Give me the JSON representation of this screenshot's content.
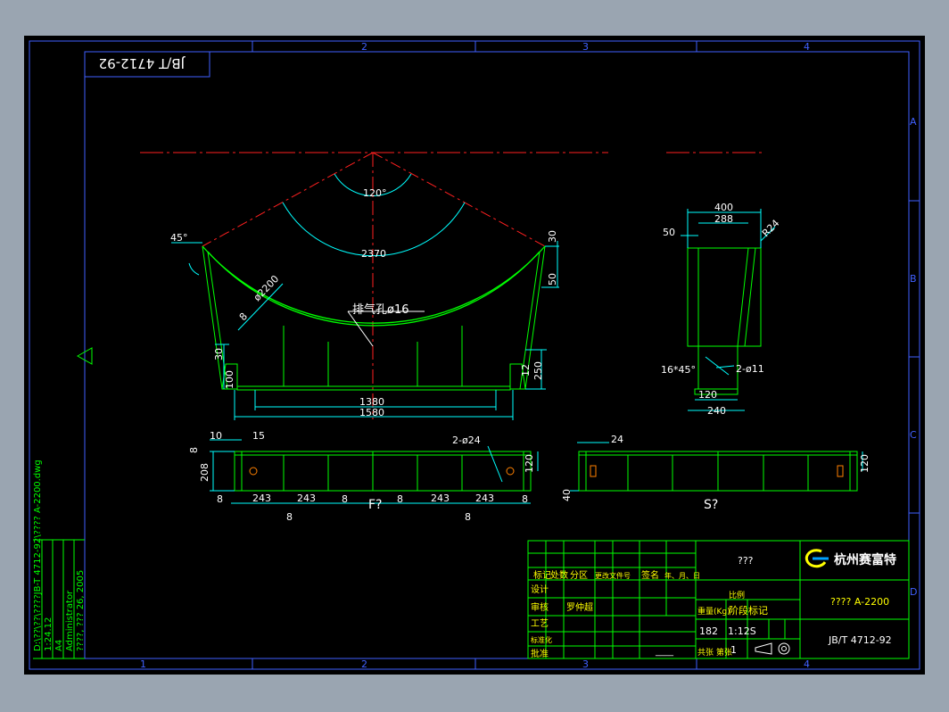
{
  "colors": {
    "background": "#9aa5b1",
    "sheet": "#000000",
    "frame": "#4060ff",
    "outline": "#00ff00",
    "centerline": "#ff2020",
    "dimension": "#00ffff",
    "text": "#ffffff",
    "title_block": "#ffff00"
  },
  "frame": {
    "col_marks_top": [
      "2",
      "3",
      "4"
    ],
    "col_marks_bottom": [
      "1",
      "2",
      "3",
      "4"
    ],
    "row_marks": [
      "A",
      "B",
      "C",
      "D"
    ]
  },
  "top_code_box": "JB/T 4712-92",
  "side_info": {
    "path": "D:\\??\\??\\????JB-T 4712-92\\???? A-2200.dwg",
    "scale": "1:24.12",
    "paper": "A4",
    "user": "Administrator",
    "date": "????, ??? 26, 2005",
    "labels": [
      "文件名",
      "比例",
      "图幅",
      "绘图者",
      "日期"
    ]
  },
  "front_view": {
    "angle": "120°",
    "arc_length": "2370",
    "chamfer_angle": "45°",
    "radius": "ø2200",
    "thickness": "8",
    "vent_hole": "排气孔ø16",
    "dim_30_top": "30",
    "dim_50": "50",
    "dim_30_left": "30",
    "dim_100": "100",
    "dim_12": "12",
    "dim_250": "250",
    "width_inner": "1380",
    "width_outer": "1580"
  },
  "side_view": {
    "dim_400": "400",
    "dim_288": "288",
    "dim_50": "50",
    "radius": "R24",
    "chamfer": "16*45°",
    "holes": "2-ø11",
    "dim_120": "120",
    "dim_240": "240"
  },
  "plan_f": {
    "dim_10": "10",
    "dim_15": "15",
    "dim_8_top": "8",
    "dim_208": "208",
    "holes": "2-ø24",
    "dim_120": "120",
    "spacings": [
      "8",
      "243",
      "243",
      "8",
      "8",
      "243",
      "243",
      "8"
    ],
    "rib_8a": "8",
    "rib_8b": "8",
    "label": "F?"
  },
  "plan_s": {
    "dim_24": "24",
    "dim_120": "120",
    "dim_40": "40",
    "label": "S?"
  },
  "title_block": {
    "name": "???",
    "company": "杭州赛富特",
    "drawing_title": "???? A-2200",
    "drawing_number": "JB/T 4712-92",
    "weight": "182",
    "scale": "1:12S",
    "sheets": "1",
    "rev_headers": [
      "标记",
      "处数",
      "分区",
      "更改文件号",
      "签名",
      "年、月、日"
    ],
    "row_labels": [
      "设计",
      "审核",
      "工艺",
      "标准化",
      "批准"
    ],
    "signer": "罗仲超",
    "date_fill": "____",
    "stage_label": "阶段标记",
    "weight_label": "重量(Kg)",
    "scale_label": "比例",
    "sheet_label": "共张 第张"
  }
}
